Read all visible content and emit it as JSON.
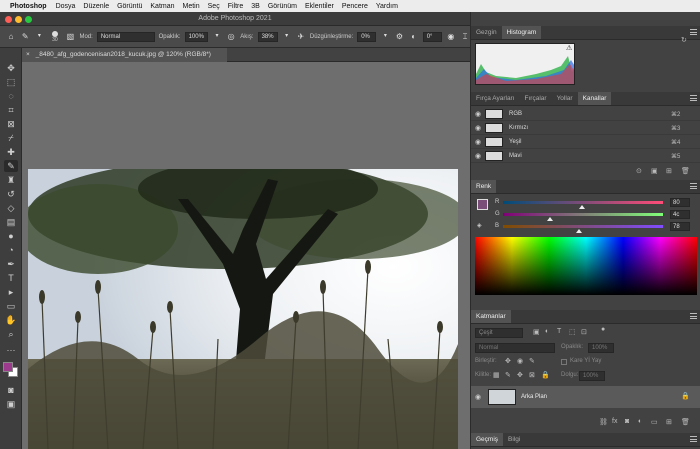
{
  "menubar": {
    "app": "Photoshop",
    "items": [
      "Dosya",
      "Düzenle",
      "Görüntü",
      "Katman",
      "Metin",
      "Seç",
      "Filtre",
      "3B",
      "Görünüm",
      "Eklentiler",
      "Pencere",
      "Yardım"
    ]
  },
  "window": {
    "title": "Adobe Photoshop 2021"
  },
  "options": {
    "brush_size": "30",
    "mode_label": "Mod:",
    "mode_value": "Normal",
    "opacity_label": "Opaklık:",
    "opacity_value": "100%",
    "flow_label": "Akış:",
    "flow_value": "38%",
    "smoothing_label": "Düzgünleştirme:",
    "smoothing_value": "0%",
    "angle_value": "0°"
  },
  "document": {
    "tab_label": "_8480_afg_godencenisan2018_kucuk.jpg @ 120% (RGB/8*)"
  },
  "panels": {
    "top_tabs": [
      "Gezgin",
      "Histogram"
    ],
    "top_active": "Histogram",
    "mid_tabs": [
      "Fırça Ayarları",
      "Fırçalar",
      "Yollar",
      "Kanallar"
    ],
    "mid_active": "Kanallar",
    "channels": [
      {
        "name": "RGB",
        "shortcut": "⌘2"
      },
      {
        "name": "Kırmızı",
        "shortcut": "⌘3"
      },
      {
        "name": "Yeşil",
        "shortcut": "⌘4"
      },
      {
        "name": "Mavi",
        "shortcut": "⌘5"
      }
    ],
    "color_tab": "Renk",
    "color": {
      "r_label": "R",
      "r_value": "80",
      "g_label": "G",
      "g_value": "4c",
      "b_label": "B",
      "b_value": "78",
      "swatch": "#7a4c78"
    },
    "layers_tab": "Katmanlar",
    "layers": {
      "kind_placeholder": "Çeşit",
      "blend_mode": "Normal",
      "opacity_label": "Opaklık:",
      "opacity_value": "100%",
      "unify_label": "Birleştir:",
      "frame_label": "Kare Yİ Yay",
      "lock_label": "Kilitle:",
      "fill_label": "Dolgu:",
      "fill_value": "100%",
      "items": [
        {
          "name": "Arka Plan"
        }
      ]
    },
    "bottom_tabs": [
      "Geçmiş",
      "Bilgi"
    ],
    "bottom_active": "Geçmiş"
  },
  "colors": {
    "foreground": "#9c3b8e",
    "background": "#ffffff",
    "accent": "#2f7de0"
  },
  "icons": {
    "toolbar": [
      "move-icon",
      "marquee-icon",
      "lasso-icon",
      "crop-icon",
      "frame-icon",
      "eyedropper-icon",
      "healing-icon",
      "brush-icon",
      "stamp-icon",
      "history-brush-icon",
      "eraser-icon",
      "gradient-icon",
      "blur-icon",
      "dodge-icon",
      "pen-icon",
      "type-icon",
      "path-select-icon",
      "shape-icon",
      "hand-icon",
      "zoom-icon"
    ]
  }
}
